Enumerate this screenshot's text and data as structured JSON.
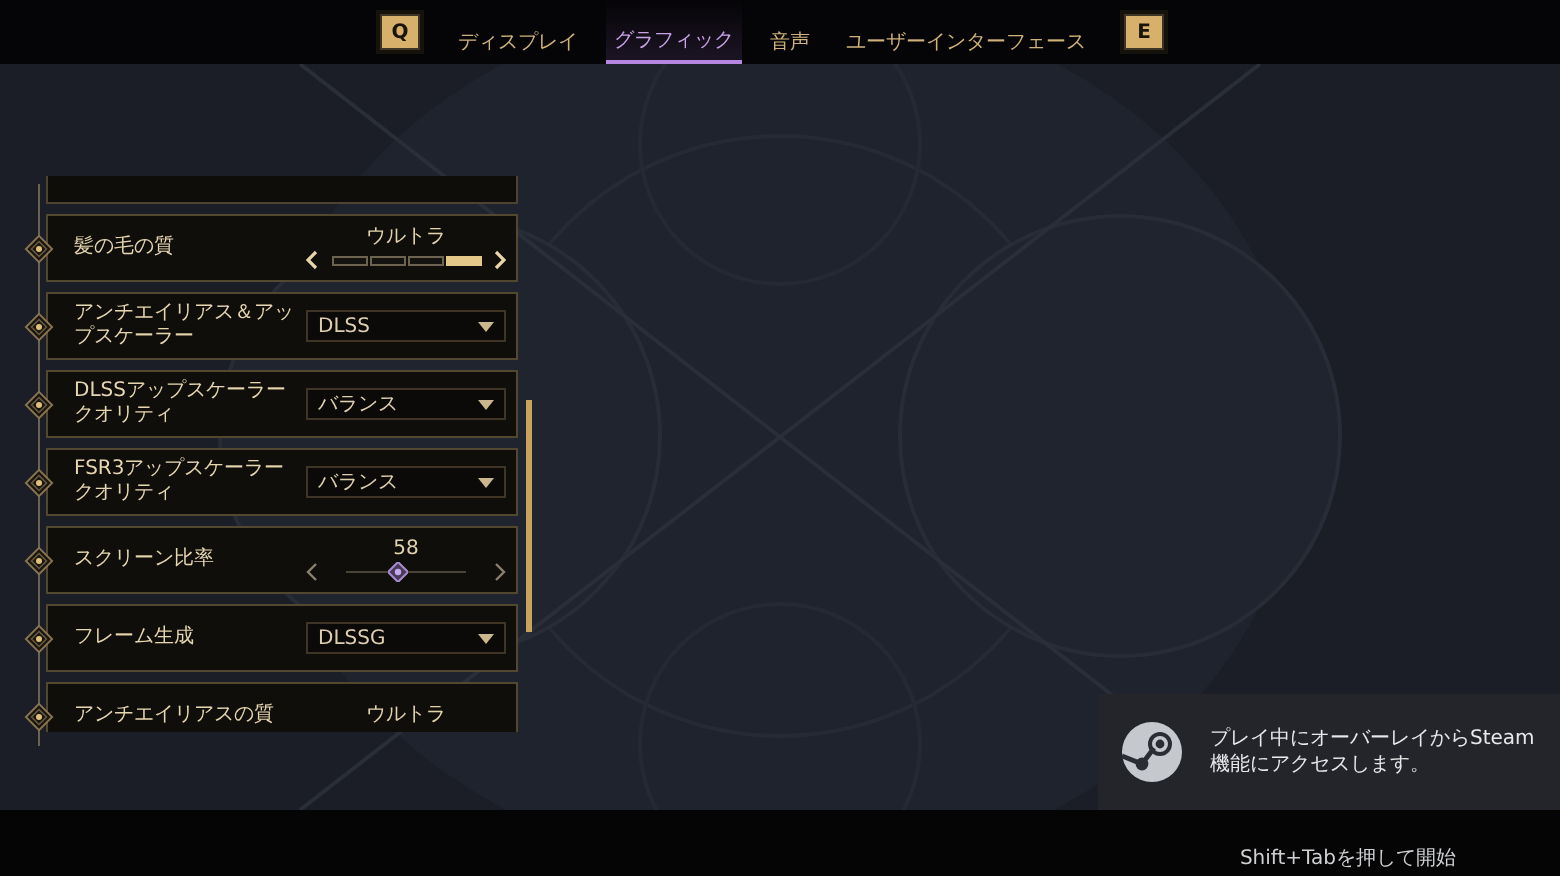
{
  "top_bar": {
    "left_key": "Q",
    "right_key": "E",
    "tabs": [
      {
        "label": "ディスプレイ",
        "selected": false
      },
      {
        "label": "グラフィック",
        "selected": true
      },
      {
        "label": "音声",
        "selected": false
      },
      {
        "label": "ユーザーインターフェース",
        "selected": false
      }
    ]
  },
  "settings": [
    {
      "kind": "selector",
      "label": "髪の毛の質",
      "value": "ウルトラ",
      "segments": [
        {
          "selected": false
        },
        {
          "selected": false
        },
        {
          "selected": false
        },
        {
          "selected": true
        }
      ]
    },
    {
      "kind": "dropdown",
      "label": "アンチエイリアス＆アップスケーラー",
      "value": "DLSS"
    },
    {
      "kind": "dropdown",
      "label": "DLSSアップスケーラークオリティ",
      "value": "バランス"
    },
    {
      "kind": "dropdown",
      "label": "FSR3アップスケーラークオリティ",
      "value": "バランス"
    },
    {
      "kind": "slider",
      "label": "スクリーン比率",
      "value": "58",
      "level": 0.44
    },
    {
      "kind": "dropdown",
      "label": "フレーム生成",
      "value": "DLSSG"
    },
    {
      "kind": "selector",
      "label": "アンチエイリアスの質",
      "value": "ウルトラ"
    }
  ],
  "notification": {
    "message": "プレイ中にオーバーレイからSteam機能にアクセスします。"
  },
  "bottom_bar": {
    "hint": "Shift+Tabを押して開始"
  }
}
